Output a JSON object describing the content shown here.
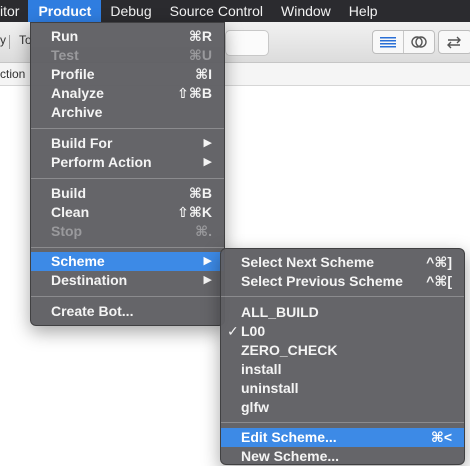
{
  "menubar": {
    "items": [
      "itor",
      "Product",
      "Debug",
      "Source Control",
      "Window",
      "Help"
    ],
    "active_index": 1
  },
  "toolbar": {
    "left_text": "y",
    "left_text_2": "To",
    "subbar_text": "ction"
  },
  "product_menu": {
    "groups": [
      [
        {
          "label": "Run",
          "shortcut": "⌘R",
          "enabled": true
        },
        {
          "label": "Test",
          "shortcut": "⌘U",
          "enabled": false
        },
        {
          "label": "Profile",
          "shortcut": "⌘I",
          "enabled": true
        },
        {
          "label": "Analyze",
          "shortcut": "⇧⌘B",
          "enabled": true
        },
        {
          "label": "Archive",
          "shortcut": "",
          "enabled": true
        }
      ],
      [
        {
          "label": "Build For",
          "submenu": true,
          "enabled": true
        },
        {
          "label": "Perform Action",
          "submenu": true,
          "enabled": true
        }
      ],
      [
        {
          "label": "Build",
          "shortcut": "⌘B",
          "enabled": true
        },
        {
          "label": "Clean",
          "shortcut": "⇧⌘K",
          "enabled": true
        },
        {
          "label": "Stop",
          "shortcut": "⌘.",
          "enabled": false
        }
      ],
      [
        {
          "label": "Scheme",
          "submenu": true,
          "enabled": true,
          "highlighted": true
        },
        {
          "label": "Destination",
          "submenu": true,
          "enabled": true
        }
      ],
      [
        {
          "label": "Create Bot...",
          "shortcut": "",
          "enabled": true
        }
      ]
    ]
  },
  "scheme_menu": {
    "groups": [
      [
        {
          "label": "Select Next Scheme",
          "shortcut": "^⌘]"
        },
        {
          "label": "Select Previous Scheme",
          "shortcut": "^⌘["
        }
      ],
      [
        {
          "label": "ALL_BUILD",
          "checked": false
        },
        {
          "label": "L00",
          "checked": true
        },
        {
          "label": "ZERO_CHECK",
          "checked": false
        },
        {
          "label": "install",
          "checked": false
        },
        {
          "label": "uninstall",
          "checked": false
        },
        {
          "label": "glfw",
          "checked": false
        }
      ],
      [
        {
          "label": "Edit Scheme...",
          "shortcut": "⌘<",
          "highlighted": true
        },
        {
          "label": "New Scheme...",
          "shortcut": ""
        }
      ]
    ]
  },
  "icons": {
    "checkmark": "✓",
    "submenu_arrow": "▶"
  },
  "colors": {
    "menubar": "#2b2b2f",
    "highlight": "#3d8ae6",
    "menu_bg": "#606064"
  }
}
